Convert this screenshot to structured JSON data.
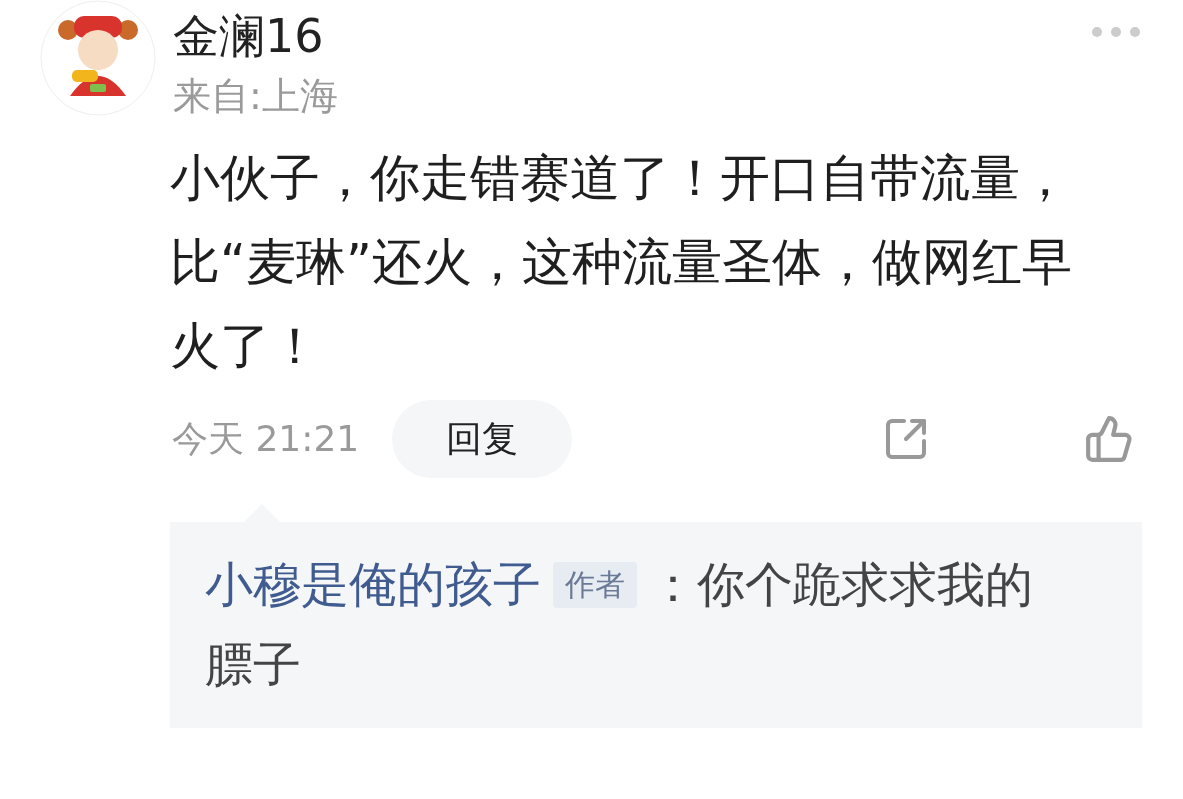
{
  "comment": {
    "author": "金澜16",
    "location": "来自:上海",
    "text": "小伙子，你走错赛道了！开口自带流量，比“麦琳”还火，这种流量圣体，做网红早火了！",
    "time": "今天 21:21",
    "reply_button": "回复"
  },
  "replies": [
    {
      "author": "小穆是俺的孩子",
      "badge": "作者",
      "text": "：你个跪求求我的膘子"
    }
  ]
}
